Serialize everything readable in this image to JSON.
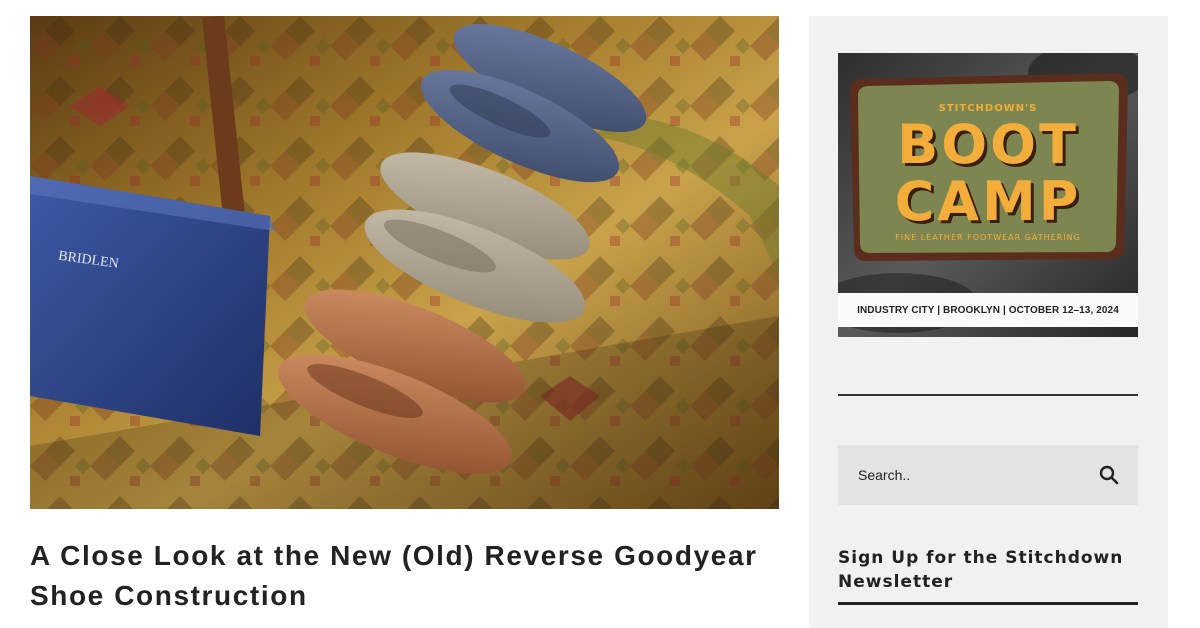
{
  "hero": {
    "box_brand": "BRIDLEN"
  },
  "article": {
    "title": "A Close Look at the New (Old) Reverse Goodyear Shoe Construction"
  },
  "sidebar": {
    "ad": {
      "kicker": "STITCHDOWN'S",
      "line1": "BOOT",
      "line2": "CAMP",
      "tagline": "FINE LEATHER FOOTWEAR GATHERING",
      "details": "INDUSTRY CITY | BROOKLYN | OCTOBER 12–13, 2024"
    },
    "search": {
      "placeholder": "Search.."
    },
    "newsletter": {
      "title": "Sign Up for the Stitchdown Newsletter"
    }
  },
  "colors": {
    "ad_panel": "#7d8650",
    "ad_yellow": "#f2ad3b",
    "ad_border": "#5a2d1c",
    "sidebar_bg": "#f1f1f1",
    "search_bg": "#e3e3e3"
  }
}
